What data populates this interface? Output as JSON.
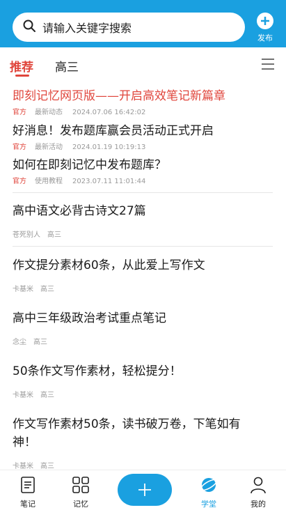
{
  "search": {
    "placeholder": "请输入关键字搜索"
  },
  "publish": {
    "label": "发布"
  },
  "tabs": [
    {
      "label": "推荐"
    },
    {
      "label": "高三"
    }
  ],
  "notices": [
    {
      "title": "即刻记忆网页版——开启高效笔记新篇章",
      "source": "官方",
      "category": "最新动态",
      "time": "2024.07.06 16:42:02"
    },
    {
      "title": "好消息！发布题库赢会员活动正式开启",
      "source": "官方",
      "category": "最新活动",
      "time": "2024.01.19 10:19:13"
    },
    {
      "title": "如何在即刻记忆中发布题库？",
      "source": "官方",
      "category": "使用教程",
      "time": "2023.07.11 11:01:44"
    }
  ],
  "posts": [
    {
      "title": "高中语文必背古诗文27篇",
      "author": "苍死别人",
      "grade": "高三"
    },
    {
      "title": "作文提分素材60条，从此爱上写作文",
      "author": "卡基米",
      "grade": "高三"
    },
    {
      "title": "高中三年级政治考试重点笔记",
      "author": "念尘",
      "grade": "高三"
    },
    {
      "title": "50条作文写作素材，轻松提分！",
      "author": "卡基米",
      "grade": "高三"
    },
    {
      "title": "作文写作素材50条，读书破万卷，下笔如有神！",
      "author": "卡基米",
      "grade": "高三"
    }
  ],
  "bottom_nav": [
    {
      "label": "笔记",
      "icon": "note-icon"
    },
    {
      "label": "记忆",
      "icon": "grid-icon"
    },
    {
      "label": "学堂",
      "icon": "planet-icon"
    },
    {
      "label": "我的",
      "icon": "person-icon"
    }
  ],
  "colors": {
    "primary": "#1aa0e0",
    "accent": "#e0463c"
  }
}
